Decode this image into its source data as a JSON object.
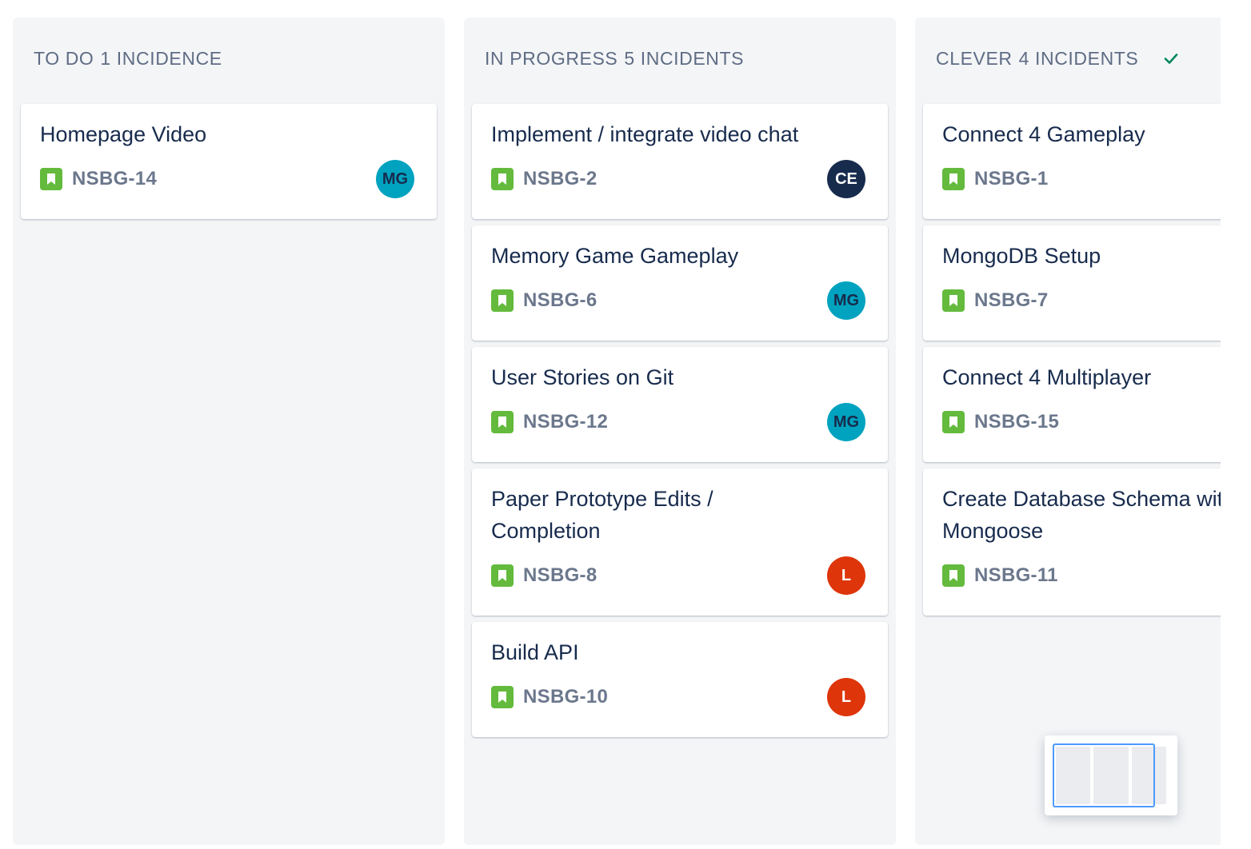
{
  "columns": [
    {
      "name": "TO DO",
      "count_label": "1 INCIDENCE",
      "cards": [
        {
          "title": "Homepage Video",
          "key": "NSBG-14",
          "assignee": "MG",
          "assignee_color": "#00a3bf"
        }
      ]
    },
    {
      "name": "IN PROGRESS",
      "count_label": "5 INCIDENTS",
      "cards": [
        {
          "title": "Implement / integrate video chat",
          "key": "NSBG-2",
          "assignee": "CE",
          "assignee_color": "#172b4d"
        },
        {
          "title": "Memory Game Gameplay",
          "key": "NSBG-6",
          "assignee": "MG",
          "assignee_color": "#00a3bf"
        },
        {
          "title": "User Stories on Git",
          "key": "NSBG-12",
          "assignee": "MG",
          "assignee_color": "#00a3bf"
        },
        {
          "title": "Paper Prototype Edits / Completion",
          "key": "NSBG-8",
          "assignee": "L",
          "assignee_color": "#de350b"
        },
        {
          "title": "Build API",
          "key": "NSBG-10",
          "assignee": "L",
          "assignee_color": "#de350b"
        }
      ]
    },
    {
      "name": "CLEVER",
      "count_label": "4 INCIDENTS",
      "done_icon": "check-icon",
      "cards": [
        {
          "title": "Connect 4 Gameplay",
          "key": "NSBG-1"
        },
        {
          "title": "MongoDB Setup",
          "key": "NSBG-7"
        },
        {
          "title": "Connect 4 Multiplayer",
          "key": "NSBG-15"
        },
        {
          "title_line1": "Create Database Schema with",
          "title_line2": "Mongoose",
          "key": "NSBG-11"
        }
      ]
    }
  ],
  "icons": {
    "issue_type": "story-bookmark-icon",
    "issue_type_color": "#63ba3c",
    "done": "check-icon",
    "done_color": "#00875a"
  }
}
